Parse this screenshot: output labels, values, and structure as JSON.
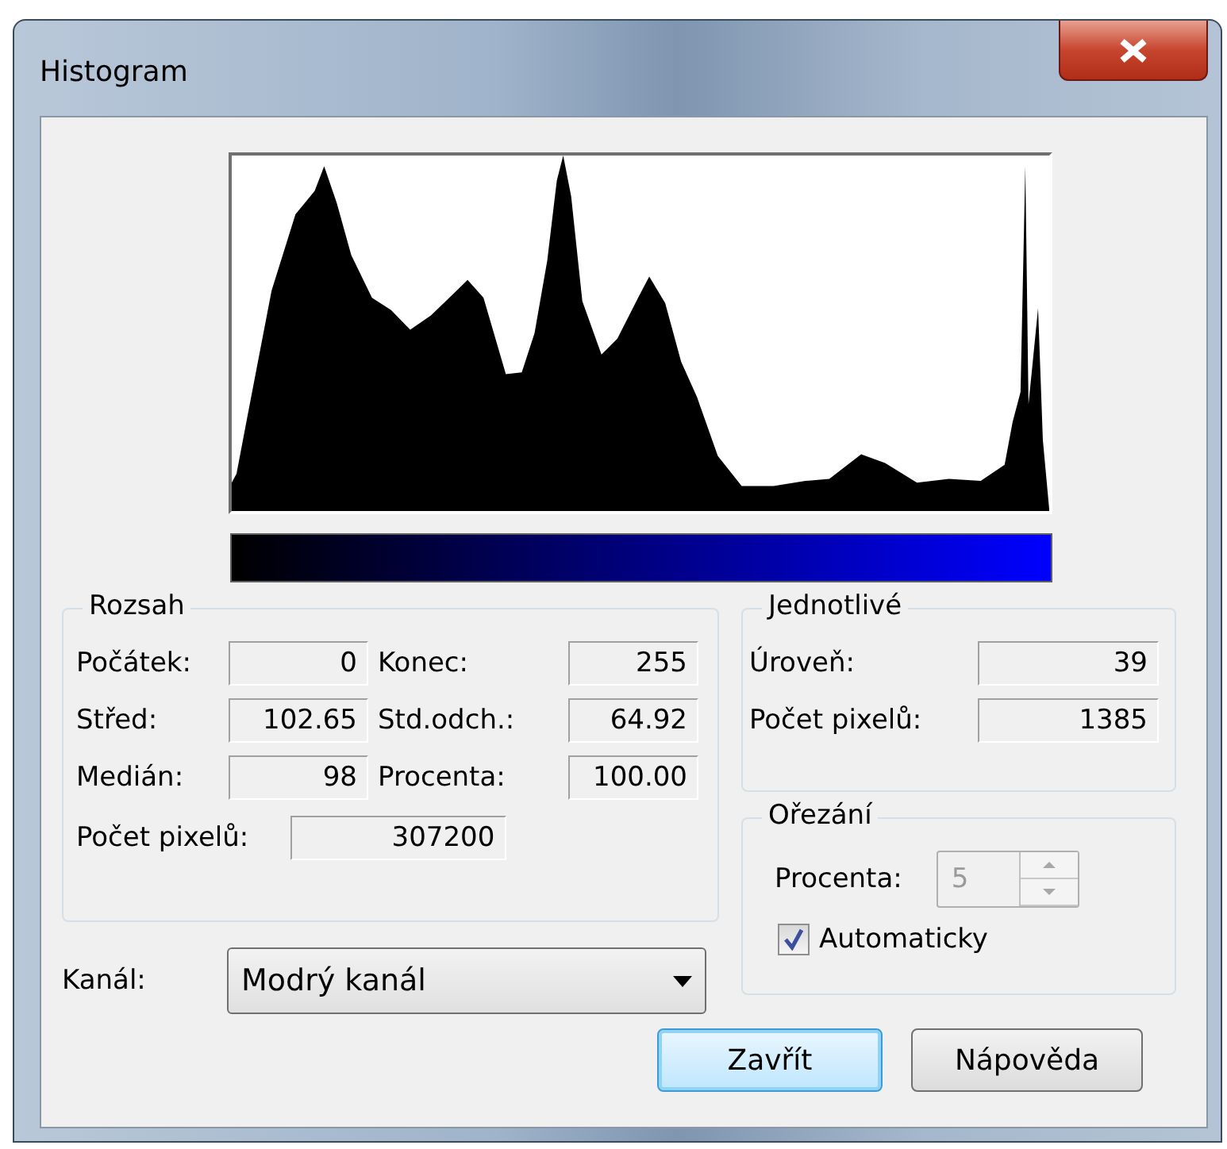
{
  "window": {
    "title": "Histogram"
  },
  "range_group": {
    "title": "Rozsah",
    "fields": [
      {
        "label": "Počátek:",
        "value": "0"
      },
      {
        "label": "Konec:",
        "value": "255"
      },
      {
        "label": "Střed:",
        "value": "102.65"
      },
      {
        "label": "Std.odch.:",
        "value": "64.92"
      },
      {
        "label": "Medián:",
        "value": "98"
      },
      {
        "label": "Procenta:",
        "value": "100.00"
      }
    ],
    "pixel_count": {
      "label": "Počet pixelů:",
      "value": "307200"
    }
  },
  "single_group": {
    "title": "Jednotlivé",
    "fields": [
      {
        "label": "Úroveň:",
        "value": "39"
      },
      {
        "label": "Počet pixelů:",
        "value": "1385"
      }
    ]
  },
  "clip_group": {
    "title": "Ořezání",
    "spinner": {
      "label": "Procenta:",
      "value": "5",
      "disabled": true
    },
    "checkbox": {
      "label": "Automaticky",
      "checked": true
    }
  },
  "channel": {
    "label": "Kanál:",
    "value": "Modrý kanál"
  },
  "buttons": [
    {
      "label": "Zavřít",
      "default": true
    },
    {
      "label": "Nápověda",
      "default": false
    }
  ]
}
